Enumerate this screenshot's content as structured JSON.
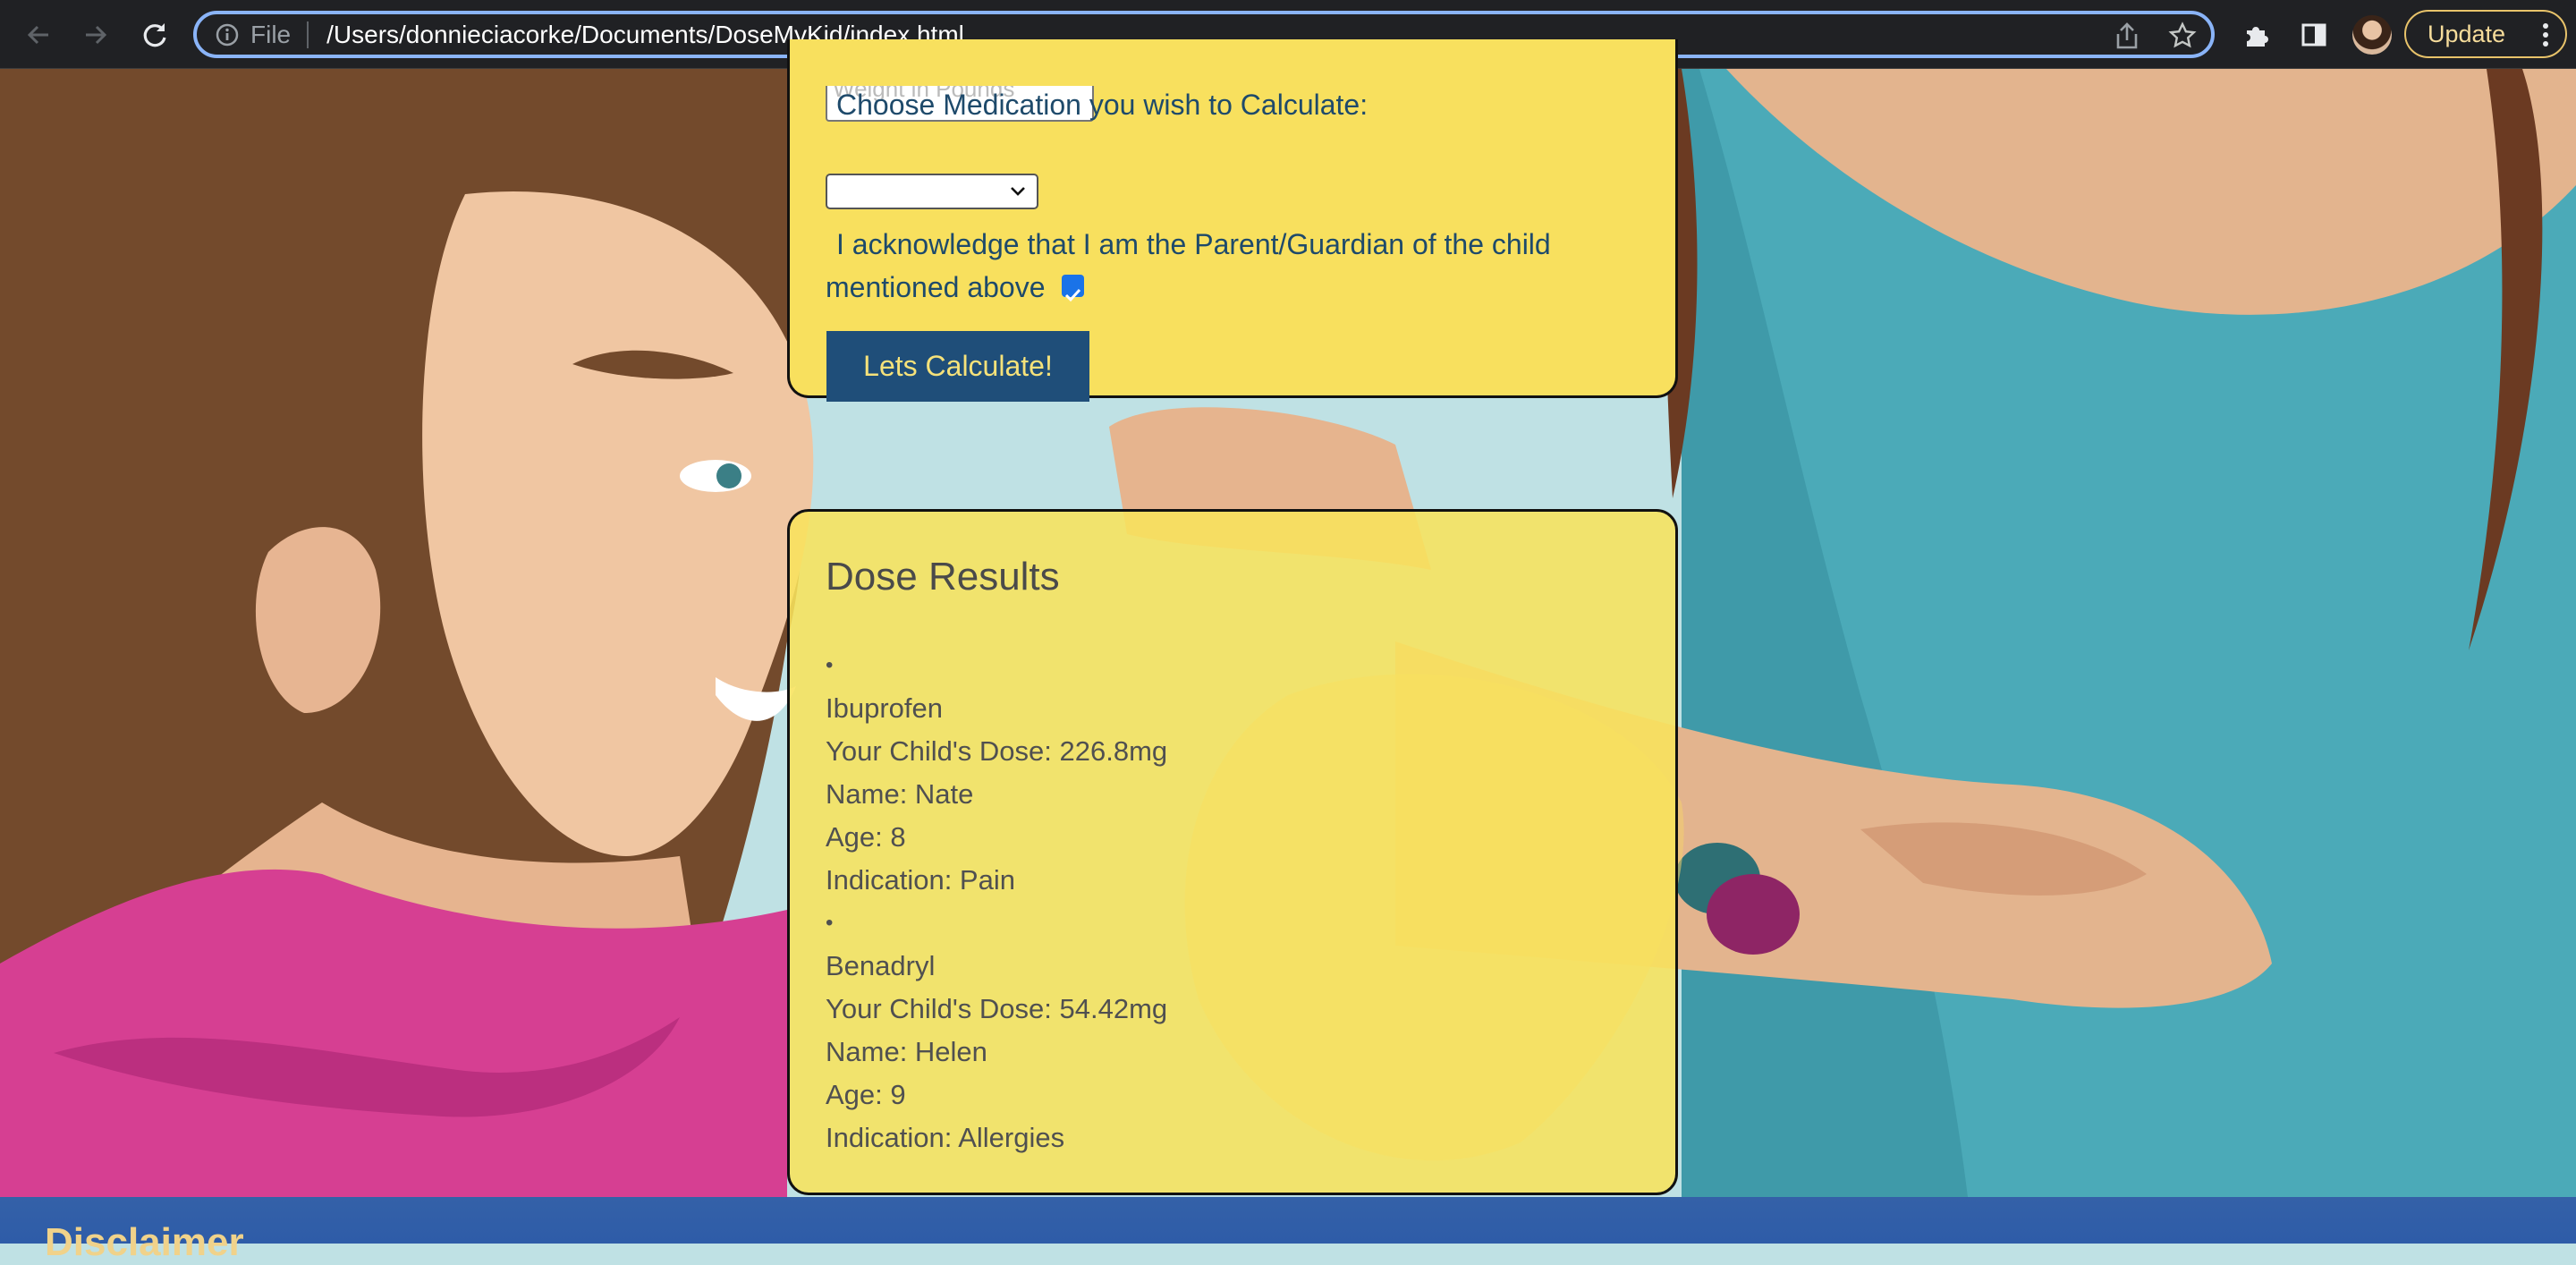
{
  "browser": {
    "nav": {
      "back_icon": "arrow-left-icon",
      "forward_icon": "arrow-right-icon",
      "reload_icon": "reload-icon"
    },
    "address_bar": {
      "scheme_label": "File",
      "url": "/Users/donnieciacorke/Documents/DoseMyKid/index.html",
      "info_icon": "info-icon",
      "share_icon": "share-icon",
      "bookmark_icon": "star-icon"
    },
    "toolbar": {
      "extensions_icon": "puzzle-icon",
      "side_panel_icon": "side-panel-icon",
      "update_label": "Update",
      "menu_icon": "more-vert-icon"
    }
  },
  "form": {
    "weight_placeholder": "Weight in Pounds",
    "medication_label": "Choose Medication you wish to Calculate:",
    "medication_selected": "",
    "acknowledge_text": "I acknowledge that I am the Parent/Guardian of the child mentioned above",
    "acknowledge_checked": true,
    "submit_label": "Lets Calculate!"
  },
  "results": {
    "title": "Dose Results",
    "items": [
      {
        "bullet": "•",
        "medication": "Ibuprofen",
        "dose": "Your Child's Dose: 226.8mg",
        "name": "Name: Nate",
        "age": "Age: 8",
        "indication": "Indication: Pain"
      },
      {
        "bullet": "•",
        "medication": "Benadryl",
        "dose": "Your Child's Dose: 54.42mg",
        "name": "Name: Helen",
        "age": "Age: 9",
        "indication": "Indication: Allergies"
      }
    ]
  },
  "footer": {
    "title": "Disclaimer"
  },
  "colors": {
    "form_card_bg": "#f8e05e",
    "button_bg": "#1f4e79",
    "button_text": "#f6e27a",
    "footer_bg": "#2e5ca8",
    "footer_text": "#f0d28a"
  }
}
